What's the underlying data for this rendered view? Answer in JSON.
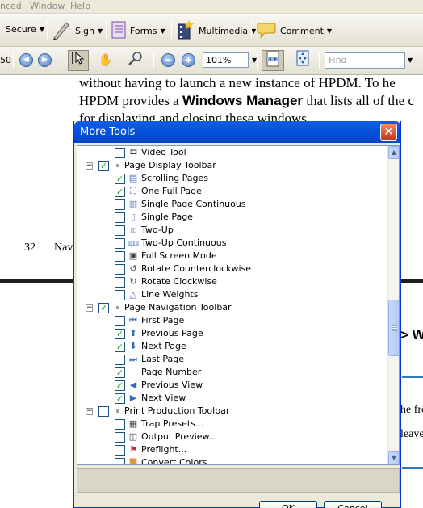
{
  "menubar": {
    "items": [
      "nced",
      "Window",
      "Help"
    ]
  },
  "toolbar1": {
    "secure_label": "Secure",
    "sign_label": "Sign",
    "forms_label": "Forms",
    "multimedia_label": "Multimedia",
    "comment_label": "Comment"
  },
  "toolbar2": {
    "page_frag": "50",
    "zoom_value": "101%",
    "find_placeholder": "Find"
  },
  "document": {
    "line1": "without having to launch a new instance of HPDM. To he",
    "line2_pre": "HPDM provides a ",
    "line2_bold": "Windows Manager",
    "line2_post": " that lists all of the c",
    "line3": "for displaying and closing these windows.",
    "page_number": "32",
    "footer_frag": "Nav",
    "heading_frag": "> W",
    "side_frag1": "he fro",
    "side_frag2": "leave"
  },
  "dialog": {
    "title": "More Tools",
    "ok_label": "OK",
    "cancel_label": "Cancel",
    "tree": [
      {
        "label": "Video Tool",
        "level": 1,
        "checked": false,
        "icon": "video-icon"
      },
      {
        "label": "Page Display Toolbar",
        "level": 0,
        "checked": true,
        "icon": "toolbar-bullet",
        "expander": "−"
      },
      {
        "label": "Scrolling Pages",
        "level": 1,
        "checked": true,
        "icon": "scrolling-pages-icon"
      },
      {
        "label": "One Full Page",
        "level": 1,
        "checked": true,
        "icon": "one-full-page-icon"
      },
      {
        "label": "Single Page Continuous",
        "level": 1,
        "checked": false,
        "icon": "single-page-continuous-icon"
      },
      {
        "label": "Single Page",
        "level": 1,
        "checked": false,
        "icon": "single-page-icon"
      },
      {
        "label": "Two-Up",
        "level": 1,
        "checked": false,
        "icon": "two-up-icon"
      },
      {
        "label": "Two-Up Continuous",
        "level": 1,
        "checked": false,
        "icon": "two-up-continuous-icon"
      },
      {
        "label": "Full Screen Mode",
        "level": 1,
        "checked": false,
        "icon": "full-screen-icon"
      },
      {
        "label": "Rotate Counterclockwise",
        "level": 1,
        "checked": false,
        "icon": "rotate-ccw-icon"
      },
      {
        "label": "Rotate Clockwise",
        "level": 1,
        "checked": false,
        "icon": "rotate-cw-icon"
      },
      {
        "label": "Line Weights",
        "level": 1,
        "checked": false,
        "icon": "line-weights-icon"
      },
      {
        "label": "Page Navigation Toolbar",
        "level": 0,
        "checked": true,
        "icon": "toolbar-bullet",
        "expander": "−"
      },
      {
        "label": "First Page",
        "level": 1,
        "checked": false,
        "icon": "first-page-icon"
      },
      {
        "label": "Previous Page",
        "level": 1,
        "checked": true,
        "icon": "previous-page-icon"
      },
      {
        "label": "Next Page",
        "level": 1,
        "checked": true,
        "icon": "next-page-icon"
      },
      {
        "label": "Last Page",
        "level": 1,
        "checked": false,
        "icon": "last-page-icon"
      },
      {
        "label": "Page Number",
        "level": 1,
        "checked": true,
        "icon": ""
      },
      {
        "label": "Previous View",
        "level": 1,
        "checked": true,
        "icon": "previous-view-icon"
      },
      {
        "label": "Next View",
        "level": 1,
        "checked": true,
        "icon": "next-view-icon"
      },
      {
        "label": "Print Production Toolbar",
        "level": 0,
        "checked": false,
        "icon": "toolbar-bullet",
        "expander": "−"
      },
      {
        "label": "Trap Presets...",
        "level": 1,
        "checked": false,
        "icon": "trap-presets-icon"
      },
      {
        "label": "Output Preview...",
        "level": 1,
        "checked": false,
        "icon": "output-preview-icon"
      },
      {
        "label": "Preflight...",
        "level": 1,
        "checked": false,
        "icon": "preflight-icon"
      },
      {
        "label": "Convert Colors...",
        "level": 1,
        "checked": false,
        "icon": "convert-colors-icon"
      }
    ]
  },
  "colors": {
    "title_bar": "#0653dd",
    "check_mark": "#21a121",
    "close_button": "#c4391c"
  }
}
